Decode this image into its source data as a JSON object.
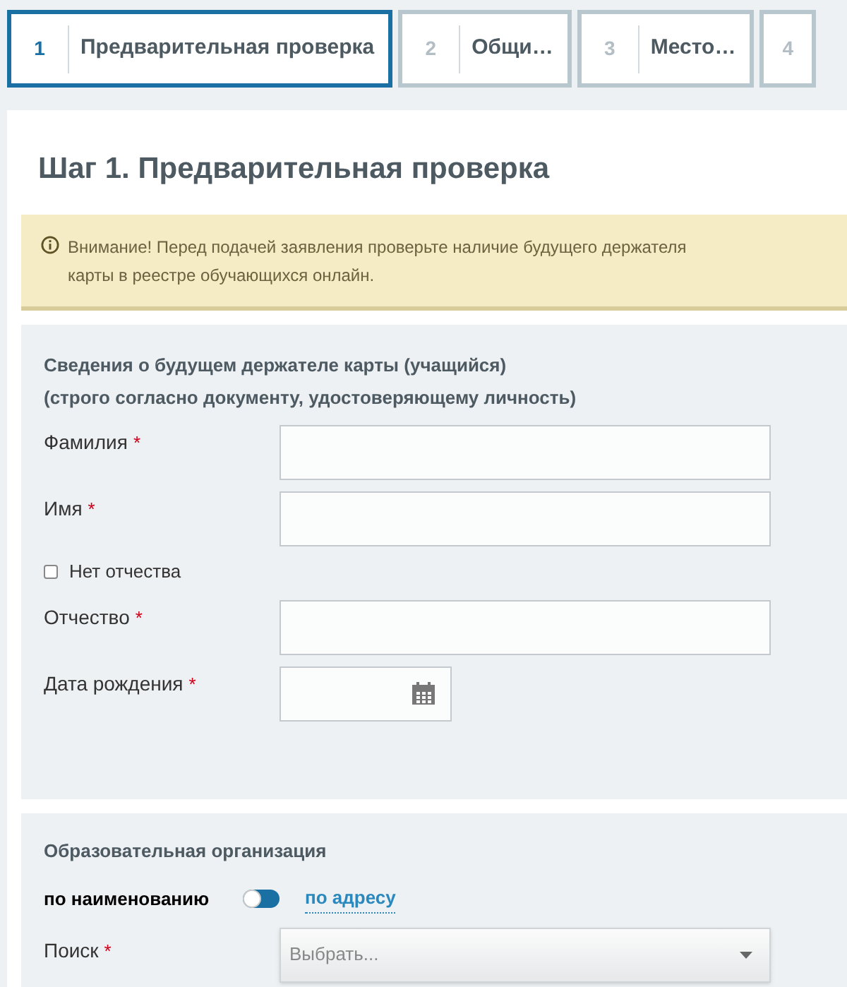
{
  "steps": [
    {
      "number": "1",
      "label": "Предварительная проверка",
      "selected": true
    },
    {
      "number": "2",
      "label": "Общи…",
      "selected": false
    },
    {
      "number": "3",
      "label": "Место…",
      "selected": false
    },
    {
      "number": "4",
      "selected": false
    }
  ],
  "title": "Шаг 1. Предварительная проверка",
  "alert": "Внимание! Перед подачей заявления проверьте наличие будущего держателя карты в реестре обучающихся онлайн.",
  "holder_section": {
    "heading": [
      "Сведения о будущем держателе карты (учащийся)",
      "(строго согласно документу, удостоверяющему личность)"
    ],
    "fields": [
      {
        "kind": "text",
        "label": "Фамилия",
        "required_mark": "*"
      },
      {
        "kind": "text",
        "label": "Имя",
        "required_mark": "*"
      },
      {
        "kind": "checkbox",
        "label": "Нет отчества",
        "checked": false
      },
      {
        "kind": "text",
        "label": "Отчество",
        "required_mark": "*"
      },
      {
        "kind": "date",
        "label": "Дата рождения",
        "required_mark": "*"
      }
    ]
  },
  "org_section": {
    "heading": "Образовательная организация",
    "toggle_left": "по наименованию",
    "toggle_on": false,
    "toggle_right": "по адресу",
    "search": {
      "label": "Поиск",
      "required_mark": "*",
      "placeholder": "Выбрать..."
    }
  }
}
